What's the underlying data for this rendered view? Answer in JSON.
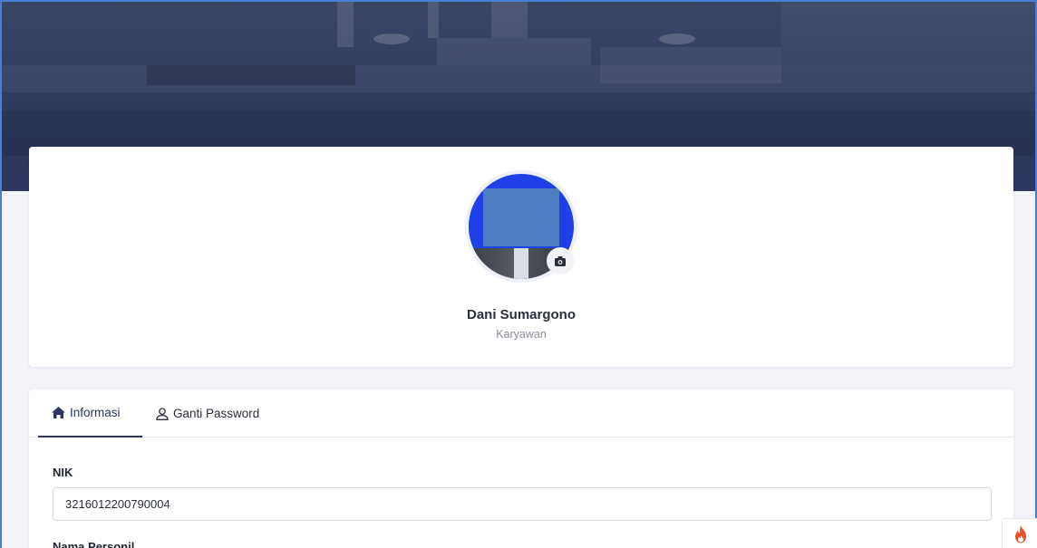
{
  "profile": {
    "name": "Dani Sumargono",
    "role": "Karyawan"
  },
  "tabs": [
    {
      "label": "Informasi",
      "icon": "home-icon",
      "active": true
    },
    {
      "label": "Ganti Password",
      "icon": "user-icon",
      "active": false
    }
  ],
  "form": {
    "nik_label": "NIK",
    "nik_value": "3216012200790004",
    "nama_label": "Nama Personil"
  },
  "colors": {
    "primary": "#2c3660",
    "cover": "#2f3a5e",
    "avatar_bg": "#1e40e6",
    "fab_flame": "#e8512a"
  },
  "icons": {
    "camera": "camera-icon",
    "fab": "flame-icon"
  }
}
